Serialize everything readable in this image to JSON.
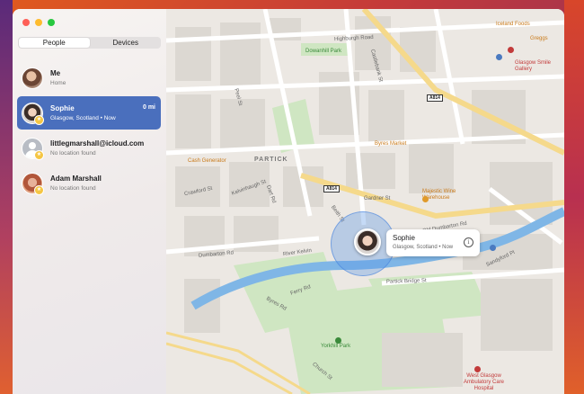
{
  "tabs": {
    "people": "People",
    "devices": "Devices"
  },
  "people": [
    {
      "name": "Me",
      "location": "Home",
      "distance": "",
      "selected": false
    },
    {
      "name": "Sophie",
      "location": "Glasgow, Scotland • Now",
      "distance": "0 mi",
      "selected": true
    },
    {
      "name": "littlegmarshall@icloud.com",
      "location": "No location found",
      "distance": "",
      "selected": false
    },
    {
      "name": "Adam Marshall",
      "location": "No location found",
      "distance": "",
      "selected": false
    }
  ],
  "map": {
    "labels": {
      "highburgh": "Highburgh Road",
      "dowanhill": "Dowanhill Park",
      "iceland": "Iceland Foods",
      "greggs": "Greggs",
      "smile": "Glasgow Smile\nGallery",
      "partick": "PARTICK",
      "byres": "Byres Market",
      "cash": "Cash Generator",
      "majestic": "Majestic Wine\nWarehouse",
      "dumbarton": "Dumbarton Rd",
      "crawford": "Crawford St",
      "kelvinhaugh": "Kelvinhaugh St",
      "dart": "Dart Rd",
      "beith": "Beith St",
      "gardner": "Gardner St",
      "rivr": "River Kelvin",
      "yorkhill": "Yorkhill Park",
      "westglasgow": "West Glasgow\nAmbulatory\nCare Hospital",
      "oldDumbarton": "Old Dumbarton Rd",
      "sandyford": "Sandyford Pl",
      "partickbridge": "Partick Bridge St",
      "ferry": "Ferry Rd",
      "byresroad": "Byres Rd",
      "church": "Church St",
      "dumbarton2": "Dumbarton Rd",
      "castlebank": "Castlebank St",
      "peel": "Peel St"
    },
    "shields": {
      "a": "A814",
      "b": "A814"
    },
    "callout": {
      "name": "Sophie",
      "status": "Glasgow, Scotland • Now"
    },
    "colors": {
      "park": "#cfe6c2",
      "water": "#7fb6e6",
      "road": "#ffffff",
      "highlight_road": "#f5d98b"
    }
  }
}
